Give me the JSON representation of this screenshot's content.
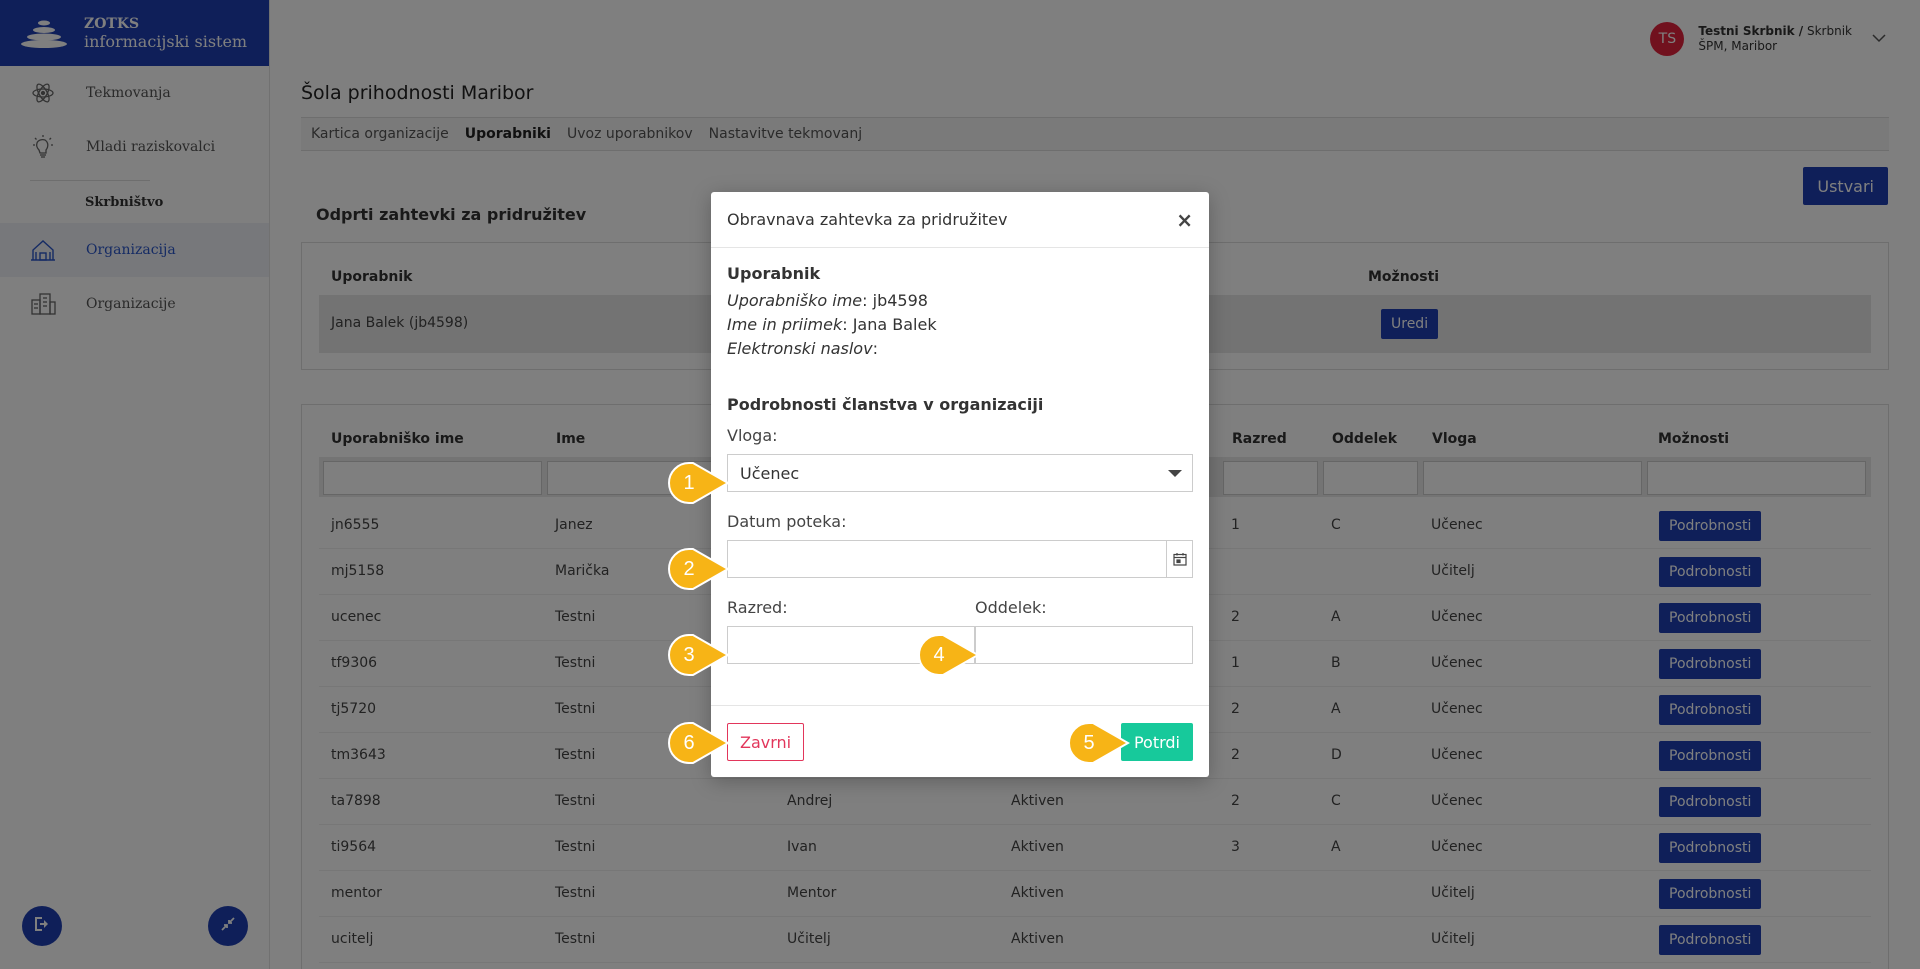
{
  "brand": {
    "line1": "ZOTKS",
    "line2": "informacijski sistem"
  },
  "sidebar": {
    "items": [
      {
        "label": "Tekmovanja",
        "icon": "atom-icon"
      },
      {
        "label": "Mladi raziskovalci",
        "icon": "lightbulb-icon"
      }
    ],
    "section": "Skrbništvo",
    "admin_items": [
      {
        "label": "Organizacija",
        "icon": "organization-icon",
        "active": true
      },
      {
        "label": "Organizacije",
        "icon": "buildings-icon"
      }
    ]
  },
  "user": {
    "initials": "TS",
    "name": "Testni Skrbnik /",
    "role": " Skrbnik",
    "org": "ŠPM, Maribor"
  },
  "page": {
    "title": "Šola prihodnosti Maribor",
    "tabs": [
      "Kartica organizacije",
      "Uporabniki",
      "Uvoz uporabnikov",
      "Nastavitve tekmovanj"
    ],
    "create_label": "Ustvari"
  },
  "requests": {
    "title": "Odprti zahtevki za pridružitev",
    "col_user": "Uporabnik",
    "col_options": "Možnosti",
    "row_user": "Jana Balek (jb4598)",
    "row_button": "Uredi"
  },
  "users_table": {
    "columns": [
      "Uporabniško ime",
      "Ime",
      "Razred",
      "Oddelek",
      "Vloga",
      "Možnosti"
    ],
    "rows": [
      {
        "username": "jn6555",
        "first": "Janez",
        "mid": "",
        "status": "",
        "grade": "1",
        "dept": "C",
        "role": "Učenec"
      },
      {
        "username": "mj5158",
        "first": "Marička",
        "mid": "",
        "status": "",
        "grade": "",
        "dept": "",
        "role": "Učitelj"
      },
      {
        "username": "ucenec",
        "first": "Testni",
        "mid": "",
        "status": "",
        "grade": "2",
        "dept": "A",
        "role": "Učenec"
      },
      {
        "username": "tf9306",
        "first": "Testni",
        "mid": "",
        "status": "",
        "grade": "1",
        "dept": "B",
        "role": "Učenec"
      },
      {
        "username": "tj5720",
        "first": "Testni",
        "mid": "",
        "status": "",
        "grade": "2",
        "dept": "A",
        "role": "Učenec"
      },
      {
        "username": "tm3643",
        "first": "Testni",
        "mid": "",
        "status": "",
        "grade": "2",
        "dept": "D",
        "role": "Učenec"
      },
      {
        "username": "ta7898",
        "first": "Testni",
        "mid": "Andrej",
        "status": "Aktiven",
        "grade": "2",
        "dept": "C",
        "role": "Učenec"
      },
      {
        "username": "ti9564",
        "first": "Testni",
        "mid": "Ivan",
        "status": "Aktiven",
        "grade": "3",
        "dept": "A",
        "role": "Učenec"
      },
      {
        "username": "mentor",
        "first": "Testni",
        "mid": "Mentor",
        "status": "Aktiven",
        "grade": "",
        "dept": "",
        "role": "Učitelj"
      },
      {
        "username": "ucitelj",
        "first": "Testni",
        "mid": "Učitelj",
        "status": "Aktiven",
        "grade": "",
        "dept": "",
        "role": "Učitelj"
      }
    ],
    "details_label": "Podrobnosti"
  },
  "modal": {
    "title": "Obravnava zahtevka za pridružitev",
    "user_heading": "Uporabnik",
    "username_label": "Uporabniško ime",
    "username_value": ": jb4598",
    "fullname_label": "Ime in priimek",
    "fullname_value": ": Jana Balek",
    "email_label": "Elektronski naslov",
    "email_value": ":",
    "membership_heading": "Podrobnosti članstva v organizaciji",
    "role_label": "Vloga:",
    "role_value": "Učenec",
    "expiry_label": "Datum poteka:",
    "expiry_value": "",
    "grade_label": "Razred:",
    "grade_value": "",
    "dept_label": "Oddelek:",
    "dept_value": "",
    "close_label": "Zavrni",
    "confirm_label": "Potrdi"
  },
  "markers": [
    "1",
    "2",
    "3",
    "4",
    "5",
    "6"
  ],
  "colors": {
    "brand": "#1e3fb2",
    "confirm": "#17c99b",
    "reject": "#e2365b",
    "marker": "#f7b416",
    "avatar": "#e2233c"
  }
}
